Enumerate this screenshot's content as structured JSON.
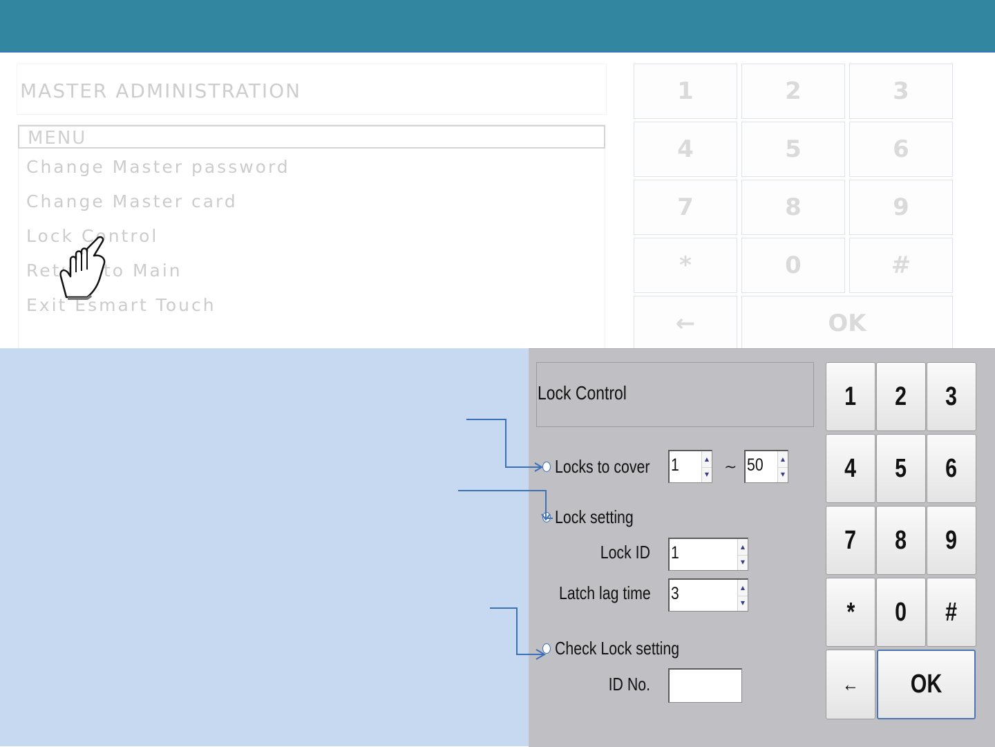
{
  "upper_screen": {
    "title": "MASTER ADMINISTRATION",
    "menu_header": "MENU",
    "menu_items": [
      "Change Master password",
      "Change Master card",
      "Lock Control",
      "Return to Main",
      "Exit Esmart Touch"
    ],
    "keypad": [
      "1",
      "2",
      "3",
      "4",
      "5",
      "6",
      "7",
      "8",
      "9",
      "*",
      "0",
      "#",
      "←",
      "OK"
    ]
  },
  "lock_control": {
    "title": "Lock Control",
    "locks_to_cover": {
      "label": "Locks to cover",
      "from": "1",
      "separator": "~",
      "to": "50"
    },
    "lock_setting": {
      "label": "Lock setting"
    },
    "lock_id": {
      "label": "Lock ID",
      "value": "1"
    },
    "latch_lag_time": {
      "label": "Latch lag time",
      "value": "3"
    },
    "check_lock_setting": {
      "label": "Check Lock setting"
    },
    "id_no": {
      "label": "ID No.",
      "value": ""
    }
  },
  "keypad": [
    "1",
    "2",
    "3",
    "4",
    "5",
    "6",
    "7",
    "8",
    "9",
    "*",
    "0",
    "#",
    "←",
    "OK"
  ],
  "colors": {
    "top_bar": "#33869f",
    "background_left": "#c6d9f0",
    "panel": "#c0bfc3",
    "connector": "#3b6fb8"
  }
}
